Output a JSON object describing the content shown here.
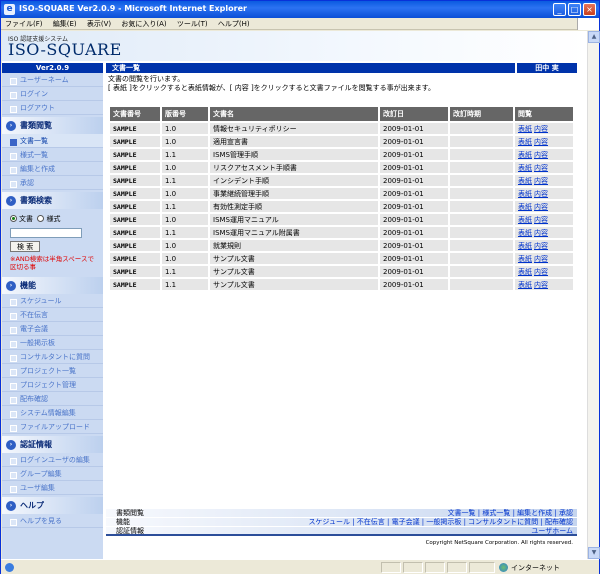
{
  "window": {
    "title": "ISO-SQUARE Ver2.0.9 - Microsoft Internet Explorer",
    "minimize": "_",
    "maximize": "□",
    "close": "×"
  },
  "menu": [
    "ファイル(F)",
    "編集(E)",
    "表示(V)",
    "お気に入り(A)",
    "ツール(T)",
    "ヘルプ(H)"
  ],
  "header": {
    "subtitle": "ISO 認証支援システム",
    "logo": "ISO-SQUARE",
    "version": "Ver2.0.9",
    "section": "文書一覧",
    "user": "田中 実"
  },
  "sidebar": {
    "top_items": [
      "ユーザーネーム",
      "ログイン",
      "ログアウト"
    ],
    "doc_head": "書類閲覧",
    "doc_items": [
      "文書一覧",
      "様式一覧",
      "編集と作成",
      "承認"
    ],
    "search_head": "書類検索",
    "search": {
      "opt1": "文書",
      "opt2": "様式",
      "value": "",
      "button": "検 索",
      "note": "※AND検索は半角スペースで区切る事"
    },
    "func_head": "機能",
    "func_items": [
      "スケジュール",
      "不在伝言",
      "電子会議",
      "一般掲示板",
      "コンサルタントに質問",
      "プロジェクト一覧",
      "プロジェクト管理",
      "配布確認",
      "システム情報編集",
      "ファイルアップロード"
    ],
    "cert_head": "認証情報",
    "cert_items": [
      "ログインユーザの編集",
      "グループ編集",
      "ユーザ編集"
    ],
    "help_head": "ヘルプ",
    "help_items": [
      "ヘルプを見る"
    ]
  },
  "main": {
    "intro1": "文書の閲覧を行います。",
    "intro2": "[ 表紙 ]をクリックすると表紙情報が、[ 内容 ]をクリックすると文書ファイルを閲覧する事が出来ます。",
    "columns": [
      "文書番号",
      "版番号",
      "文書名",
      "改訂日",
      "改訂時期",
      "閲覧"
    ],
    "link_cover": "表紙",
    "link_content": "内容",
    "rows": [
      {
        "no": "SAMPLE",
        "ver": "1.0",
        "name": "情報セキュリティポリシー",
        "date": "2009-01-01",
        "period": ""
      },
      {
        "no": "SAMPLE",
        "ver": "1.0",
        "name": "適用宣言書",
        "date": "2009-01-01",
        "period": ""
      },
      {
        "no": "SAMPLE",
        "ver": "1.1",
        "name": "ISMS管理手順",
        "date": "2009-01-01",
        "period": ""
      },
      {
        "no": "SAMPLE",
        "ver": "1.0",
        "name": "リスクアセスメント手順書",
        "date": "2009-01-01",
        "period": ""
      },
      {
        "no": "SAMPLE",
        "ver": "1.1",
        "name": "インシデント手順",
        "date": "2009-01-01",
        "period": ""
      },
      {
        "no": "SAMPLE",
        "ver": "1.0",
        "name": "事業継続管理手順",
        "date": "2009-01-01",
        "period": ""
      },
      {
        "no": "SAMPLE",
        "ver": "1.1",
        "name": "有効性測定手順",
        "date": "2009-01-01",
        "period": ""
      },
      {
        "no": "SAMPLE",
        "ver": "1.0",
        "name": "ISMS運用マニュアル",
        "date": "2009-01-01",
        "period": ""
      },
      {
        "no": "SAMPLE",
        "ver": "1.1",
        "name": "ISMS運用マニュアル附属書",
        "date": "2009-01-01",
        "period": ""
      },
      {
        "no": "SAMPLE",
        "ver": "1.0",
        "name": "就業規則",
        "date": "2009-01-01",
        "period": ""
      },
      {
        "no": "SAMPLE",
        "ver": "1.0",
        "name": "サンプル文書",
        "date": "2009-01-01",
        "period": ""
      },
      {
        "no": "SAMPLE",
        "ver": "1.1",
        "name": "サンプル文書",
        "date": "2009-01-01",
        "period": ""
      },
      {
        "no": "SAMPLE",
        "ver": "1.1",
        "name": "サンプル文書",
        "date": "2009-01-01",
        "period": ""
      }
    ]
  },
  "footer": {
    "row1_label": "書類閲覧",
    "row1_links": "文書一覧 | 様式一覧 | 編集と作成 | 承認",
    "row2_label": "機能",
    "row2_links": "スケジュール | 不在伝言 | 電子会議 | 一般掲示板 | コンサルタントに質問 | 配布確認",
    "row3_label": "認証情報",
    "row3_links": "ユーザホーム",
    "copyright": "Copyright NetSquare Corporation. All rights reserved."
  },
  "status": {
    "zone": "インターネット"
  }
}
